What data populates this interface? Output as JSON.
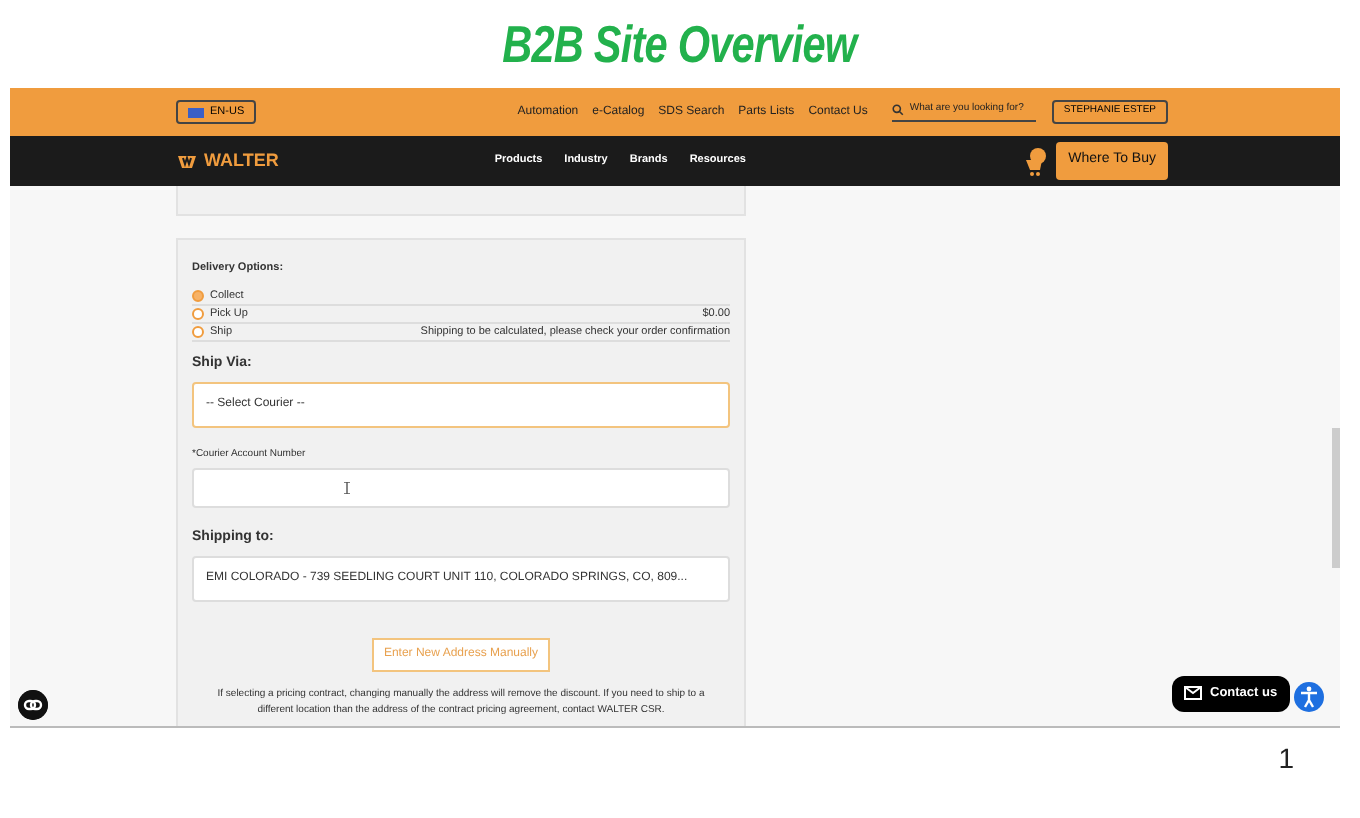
{
  "slide_title": "B2B Site Overview",
  "topbar": {
    "language": "EN-US",
    "links": [
      "Automation",
      "e-Catalog",
      "SDS Search",
      "Parts Lists",
      "Contact Us"
    ],
    "search": {
      "placeholder": "What are you looking for?"
    },
    "user": "STEPHANIE ESTEP"
  },
  "navbar": {
    "brand": "WALTER",
    "menus": [
      "Products",
      "Industry",
      "Brands",
      "Resources"
    ],
    "cta": "Where To Buy"
  },
  "delivery": {
    "heading": "Delivery Options:",
    "options": [
      {
        "label": "Collect",
        "selected": true
      },
      {
        "label": "Pick Up",
        "note": "$0.00",
        "selected": false
      },
      {
        "label": "Ship",
        "note": "Shipping to be calculated, please check your order confirmation",
        "selected": false
      }
    ],
    "ship_via_label": "Ship Via:",
    "courier_placeholder": "-- Select Courier --",
    "account_label": "*Courier Account Number",
    "shipping_to_label": "Shipping to:",
    "address": "EMI COLORADO - 739 SEEDLING COURT UNIT 110, COLORADO SPRINGS, CO, 809...",
    "new_address_button": "Enter New Address Manually",
    "notice": "If selecting a pricing contract, changing manually the address will remove the discount. If you need to ship to a different location than the address of the contract pricing agreement, contact WALTER CSR."
  },
  "contact_button": "Contact us",
  "slide_number": "1"
}
